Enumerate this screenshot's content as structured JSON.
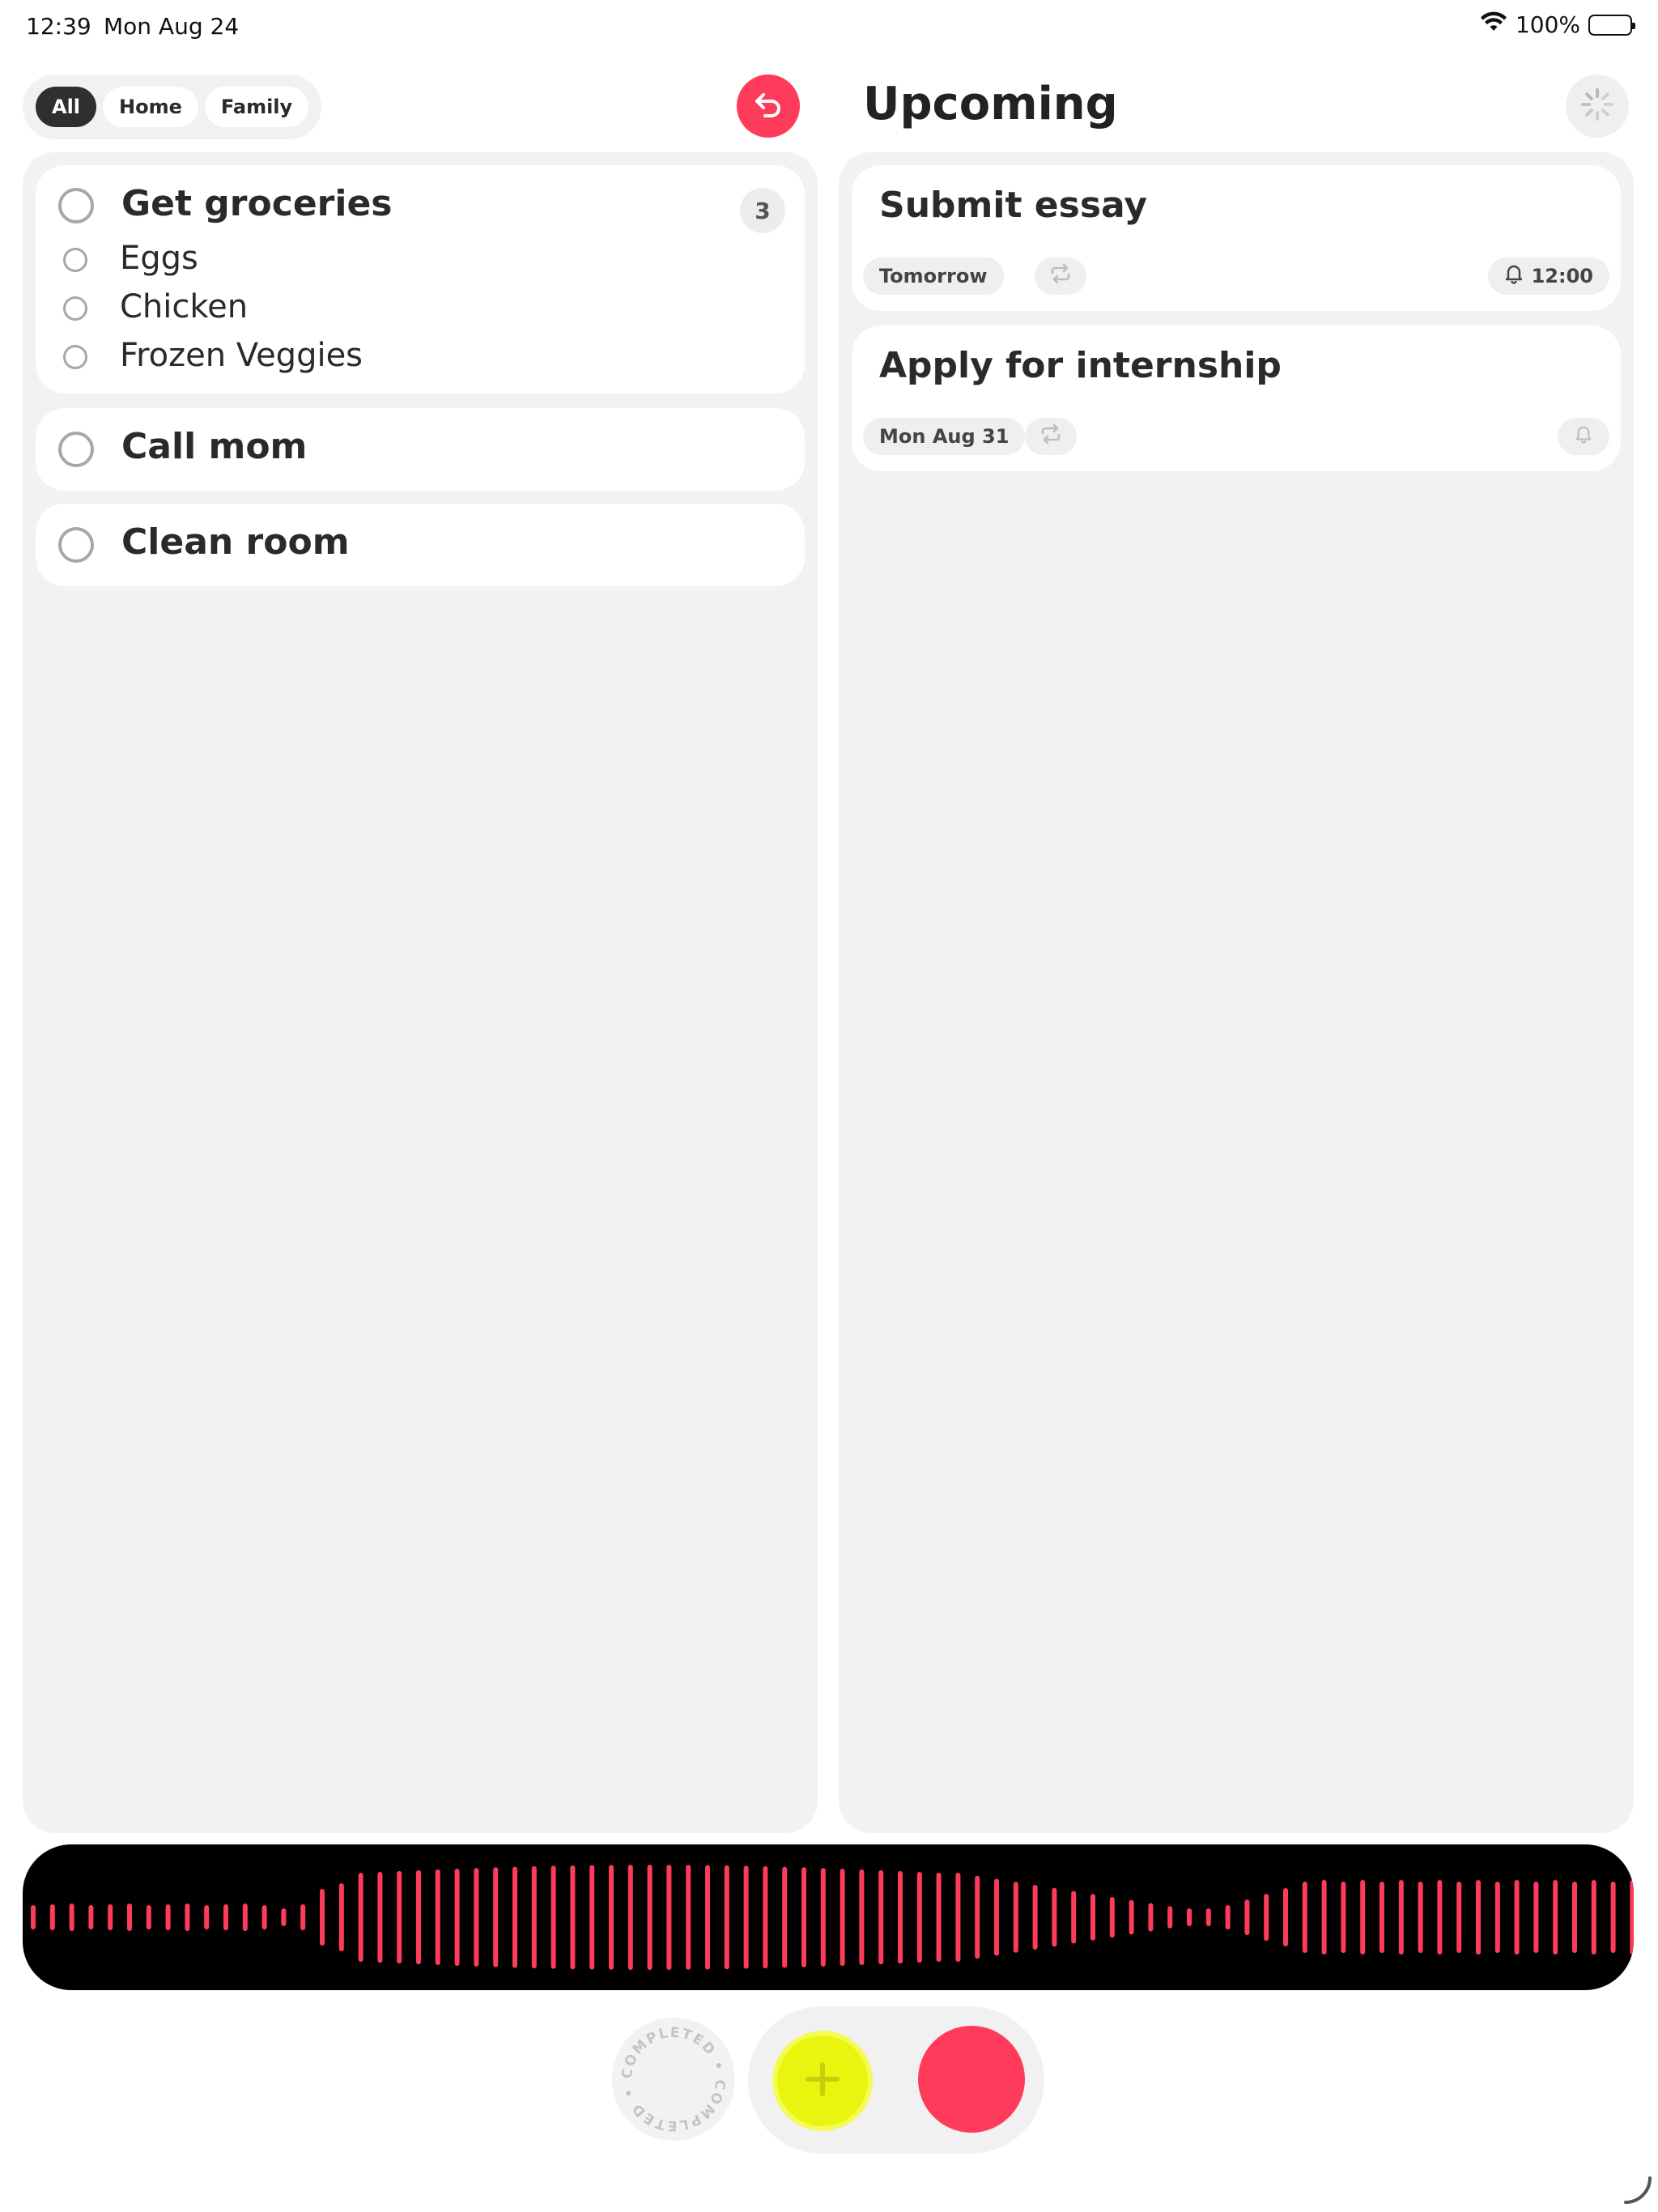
{
  "status_bar": {
    "time": "12:39",
    "date": "Mon Aug 24",
    "battery": "100%"
  },
  "filters": [
    {
      "label": "All",
      "active": true
    },
    {
      "label": "Home",
      "active": false
    },
    {
      "label": "Family",
      "active": false
    }
  ],
  "tasks": [
    {
      "title": "Get groceries",
      "count": "3",
      "subtasks": [
        "Eggs",
        "Chicken",
        "Frozen Veggies"
      ]
    },
    {
      "title": "Call mom"
    },
    {
      "title": "Clean room"
    }
  ],
  "upcoming": {
    "title": "Upcoming",
    "items": [
      {
        "title": "Submit essay",
        "date": "Tomorrow",
        "reminder": "12:00"
      },
      {
        "title": "Apply for internship",
        "date": "Mon Aug 31",
        "reminder": ""
      }
    ]
  },
  "completed_badge": {
    "text": "COMPLETED • COMPLETED •"
  },
  "colors": {
    "accent": "#ff3b5c",
    "add_button": "#e9f50f",
    "panel": "#f2f2f2",
    "waveform_bg": "#000000"
  },
  "icons": {
    "undo": "undo-arrow-icon",
    "spinner": "loading-spinner-icon",
    "repeat": "repeat-icon",
    "bell": "bell-icon",
    "plus": "plus-icon"
  }
}
